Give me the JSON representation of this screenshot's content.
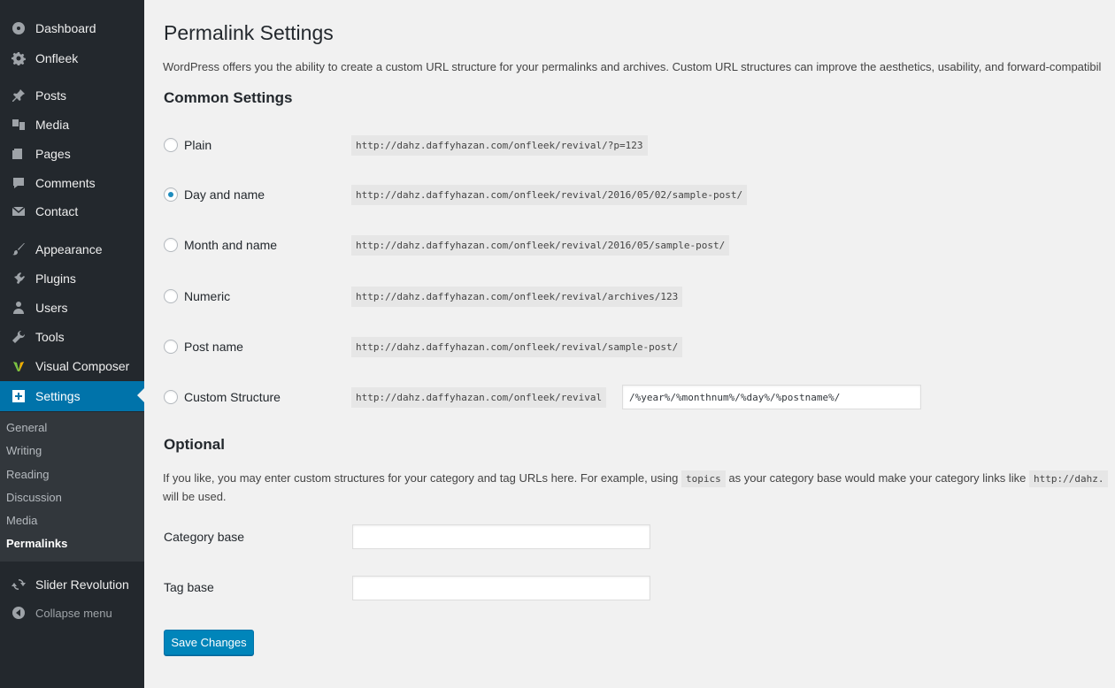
{
  "sidebar": {
    "items": [
      {
        "label": "Dashboard",
        "icon": "dashboard-icon"
      },
      {
        "label": "Onfleek",
        "icon": "gear-icon"
      },
      {
        "label": "Posts",
        "icon": "pushpin-icon"
      },
      {
        "label": "Media",
        "icon": "media-icon"
      },
      {
        "label": "Pages",
        "icon": "pages-icon"
      },
      {
        "label": "Comments",
        "icon": "comment-icon"
      },
      {
        "label": "Contact",
        "icon": "mail-icon"
      },
      {
        "label": "Appearance",
        "icon": "brush-icon"
      },
      {
        "label": "Plugins",
        "icon": "plugin-icon"
      },
      {
        "label": "Users",
        "icon": "users-icon"
      },
      {
        "label": "Tools",
        "icon": "wrench-icon"
      },
      {
        "label": "Visual Composer",
        "icon": "visual-composer-icon"
      },
      {
        "label": "Settings",
        "icon": "settings-icon"
      }
    ],
    "submenu": [
      "General",
      "Writing",
      "Reading",
      "Discussion",
      "Media",
      "Permalinks"
    ],
    "slider_revolution": "Slider Revolution",
    "collapse": "Collapse menu",
    "accent": "#0073aa"
  },
  "page": {
    "title": "Permalink Settings",
    "intro": "WordPress offers you the ability to create a custom URL structure for your permalinks and archives. Custom URL structures can improve the aesthetics, usability, and forward-compatibil",
    "common_heading": "Common Settings",
    "options": [
      {
        "label": "Plain",
        "example": "http://dahz.daffyhazan.com/onfleek/revival/?p=123",
        "checked": false
      },
      {
        "label": "Day and name",
        "example": "http://dahz.daffyhazan.com/onfleek/revival/2016/05/02/sample-post/",
        "checked": true
      },
      {
        "label": "Month and name",
        "example": "http://dahz.daffyhazan.com/onfleek/revival/2016/05/sample-post/",
        "checked": false
      },
      {
        "label": "Numeric",
        "example": "http://dahz.daffyhazan.com/onfleek/revival/archives/123",
        "checked": false
      },
      {
        "label": "Post name",
        "example": "http://dahz.daffyhazan.com/onfleek/revival/sample-post/",
        "checked": false
      },
      {
        "label": "Custom Structure",
        "example": "http://dahz.daffyhazan.com/onfleek/revival",
        "checked": false,
        "value": "/%year%/%monthnum%/%day%/%postname%/"
      }
    ],
    "optional_heading": "Optional",
    "optional_text_1": "If you like, you may enter custom structures for your category and tag URLs here. For example, using",
    "optional_code": "topics",
    "optional_text_2": "as your category base would make your category links like",
    "optional_code_2": "http://dahz.",
    "optional_text_3": "will be used.",
    "category_base_label": "Category base",
    "category_base_value": "",
    "tag_base_label": "Tag base",
    "tag_base_value": "",
    "save_label": "Save Changes"
  }
}
